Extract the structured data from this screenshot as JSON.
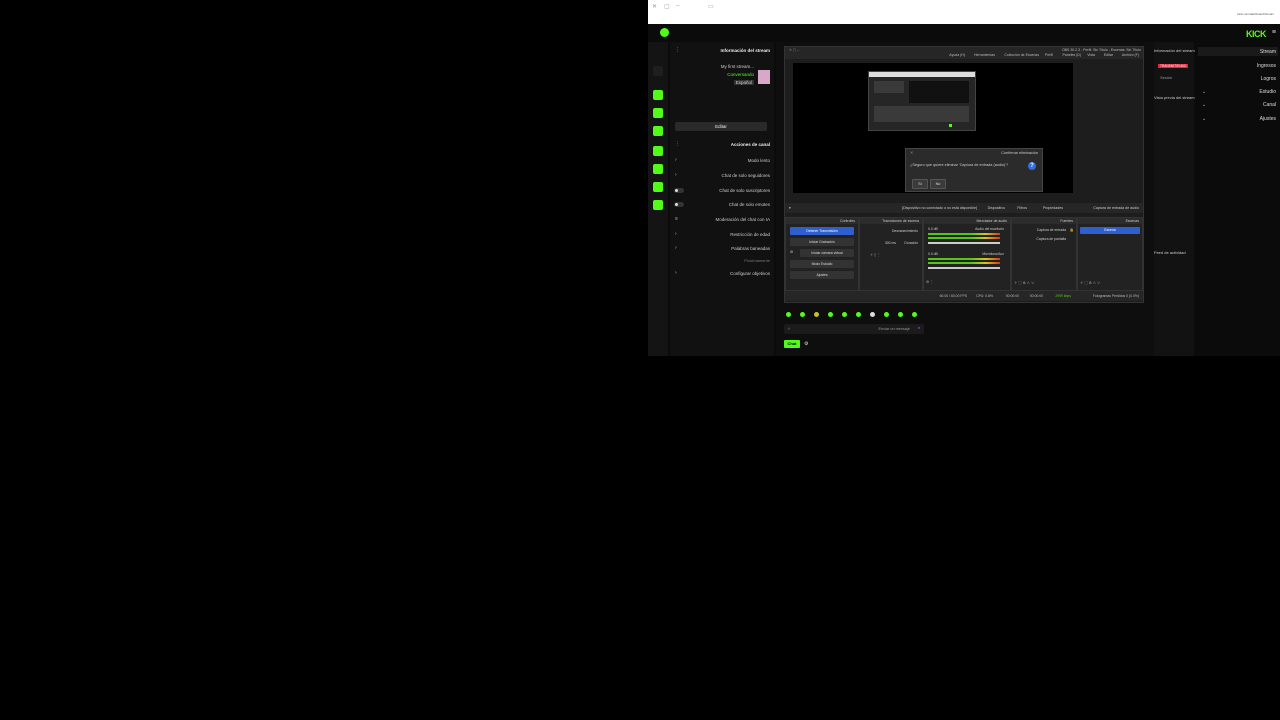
{
  "browser": {
    "url_text": "kick.com/dashboard/stream"
  },
  "header": {
    "logo_text": "KICK",
    "menu_icon": "hamburger-icon"
  },
  "left_panel": {
    "stream_info_title": "Información del stream",
    "stream_title": "My first stream...",
    "category": "Conversando",
    "tag": "Español",
    "edit_button": "Editar",
    "channel_actions_title": "Acciones de canal",
    "actions": [
      {
        "label": "Modo lento"
      },
      {
        "label": "Chat de solo seguidores"
      },
      {
        "label": "Chat de solo suscriptores"
      },
      {
        "label": "Chat de solo emotes"
      },
      {
        "label": "Moderación del chat con IA"
      },
      {
        "label": "Restricción de edad"
      },
      {
        "label": "Palabras baneadas"
      }
    ],
    "coming_soon": "Próximamente",
    "goals": "Configurar objetivos"
  },
  "obs": {
    "title_text": "OBS 30.2.3 - Perfil: Sin Título - Escenas: Sin Título",
    "menu": [
      "Archivo (F)",
      "Editar",
      "Vista",
      "Paneles (D)",
      "Perfil",
      "Colección de Escenas",
      "Herramientas",
      "Ayuda (H)"
    ],
    "dialog": {
      "title": "Confirmar eliminación",
      "question": "¿Seguro que quiere eliminar 'Captura de entrada (audio)'?",
      "yes": "Sí",
      "no": "No"
    },
    "strip": {
      "source_name": "Captura de entrada de audio",
      "properties": "Propiedades",
      "filters": "Filtros",
      "device": "Dispositivo",
      "device_value": "[Dispositivo no conectado o no está disponible]"
    },
    "docks": {
      "scenes_title": "Escenas",
      "scene_item": "Escena",
      "sources_title": "Fuentes",
      "sources": [
        "Captura de entrada",
        "Captura de pantalla"
      ],
      "mixer_title": "Mezclador de audio",
      "mixer_tracks": [
        {
          "name": "Audio del escritorio",
          "level": "0.0 dB"
        },
        {
          "name": "Micrófono/Aux",
          "level": "0.0 dB"
        }
      ],
      "transitions_title": "Transiciones de escena",
      "transition_type": "Desvanecimiento",
      "duration_label": "Duración",
      "duration_value": "300 ms",
      "controls_title": "Controles",
      "controls": [
        "Detener Transmisión",
        "Iniciar Grabación",
        "Iniciar cámara virtual",
        "Modo Estudio",
        "Ajustes"
      ]
    },
    "status": {
      "network": "Fotogramas Perdidos 0 (0.0%)",
      "bitrate": "2999 kbps",
      "live_time": "00:00:00",
      "rec_time": "00:00:00",
      "cpu": "CPU: 0.8%",
      "fps": "60.00 / 60.00 FPS"
    }
  },
  "chat": {
    "placeholder": "Enviar un mensaje",
    "send_button": "Chat"
  },
  "right_panel": {
    "title": "Información del stream",
    "live_badge": "TRANSMITIENDO",
    "session": "Sesión",
    "preview_title": "Vista previa del stream",
    "activity_title": "Feed de actividad"
  },
  "nav": {
    "items": [
      {
        "label": "Stream"
      },
      {
        "label": "Ingresos"
      },
      {
        "label": "Logros"
      },
      {
        "label": "Estudio"
      },
      {
        "label": "Canal"
      },
      {
        "label": "Ajustes"
      }
    ]
  },
  "colors": {
    "kick_green": "#53fc18",
    "obs_blue": "#2f5fcf",
    "live_red": "#e0263b"
  }
}
